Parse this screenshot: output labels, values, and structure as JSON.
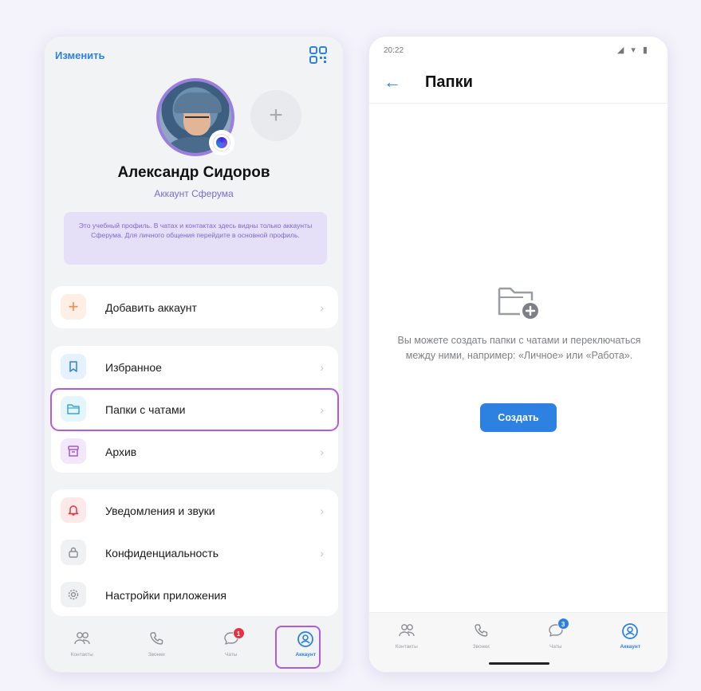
{
  "left_screen": {
    "edit_link": "Изменить",
    "profile_name": "Александр Сидоров",
    "profile_subtitle": "Аккаунт Сферума",
    "info_text": "Это учебный профиль. В чатах и контактах здесь видны только аккаунты Сферума. Для личного общения перейдите в основной профиль.",
    "add_account": "Добавить аккаунт",
    "menu": {
      "favorites": "Избранное",
      "folders": "Папки с чатами",
      "archive": "Архив",
      "notifications": "Уведомления и звуки",
      "privacy": "Конфиденциальность",
      "app_settings": "Настройки приложения"
    },
    "tabs": {
      "contacts": "Контакты",
      "calls": "Звонки",
      "chats": "Чаты",
      "account": "Аккаунт"
    },
    "chats_badge": "1"
  },
  "right_screen": {
    "status_time": "20:22",
    "title": "Папки",
    "empty_text": "Вы можете создать папки с чатами и переключаться между ними, например: «Личное» или «Работа».",
    "create_button": "Создать",
    "tabs": {
      "contacts": "Контакты",
      "calls": "Звонки",
      "chats": "Чаты",
      "account": "Аккаунт"
    },
    "chats_badge": "3"
  },
  "colors": {
    "accent": "#2d81e0",
    "highlight": "#b05be0",
    "sferum_violet": "#7a6ad1"
  }
}
